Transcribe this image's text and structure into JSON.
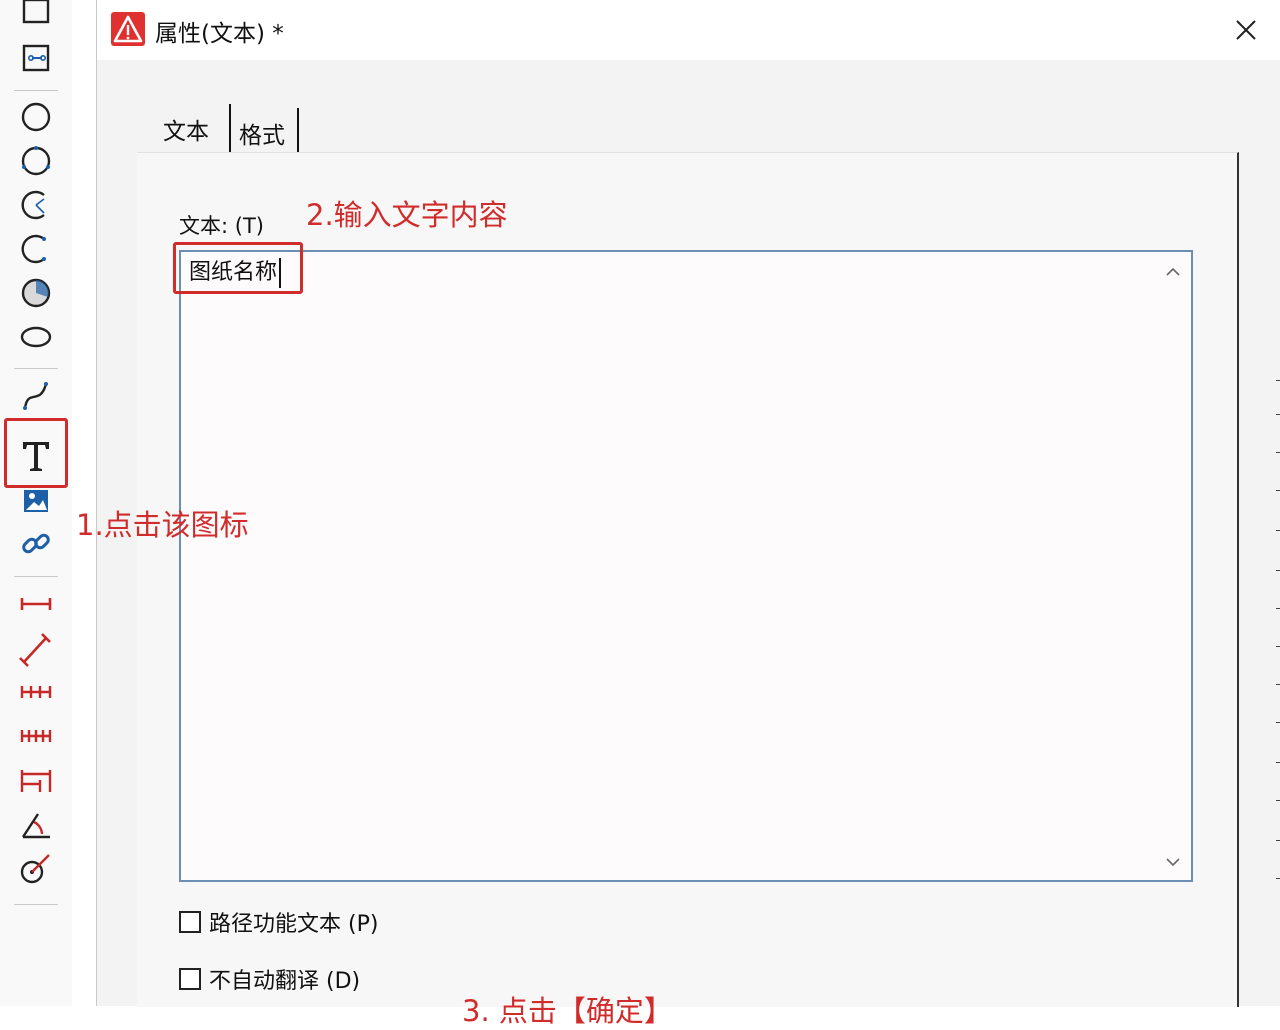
{
  "dialog": {
    "title": "属性(文本) *",
    "tabs": [
      {
        "label": "文本",
        "active": true
      },
      {
        "label": "格式",
        "active": false
      }
    ],
    "text_field": {
      "label": "文本: (T)",
      "value": "图纸名称"
    },
    "checkboxes": [
      {
        "label": "路径功能文本 (P)",
        "checked": false
      },
      {
        "label": "不自动翻译 (D)",
        "checked": false
      }
    ]
  },
  "toolbar": {
    "tools": [
      "rectangle-icon",
      "rect-connector-icon",
      "circle-icon",
      "circle-3point-icon",
      "arc-icon",
      "arc-3point-icon",
      "sector-icon",
      "ellipse-icon",
      "spline-icon",
      "text-icon",
      "image-icon",
      "link-icon",
      "dim-linear-icon",
      "dim-aligned-icon",
      "dim-chain-icon",
      "dim-continuous-icon",
      "dim-baseline-icon",
      "dim-angle-icon",
      "dim-radius-icon"
    ],
    "selected_tool": "text-icon"
  },
  "annotations": {
    "step1": "1.点击该图标",
    "step2": "2.输入文字内容",
    "step3": "3. 点击【确定】"
  },
  "colors": {
    "annotation_red": "#d12c2c",
    "dimension_red": "#c62828",
    "icon_blue": "#1e5fa8",
    "field_border": "#6a8fb3"
  }
}
